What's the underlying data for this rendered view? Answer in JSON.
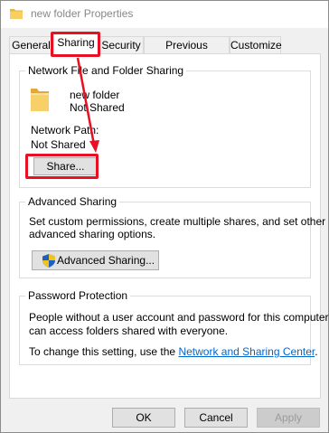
{
  "window": {
    "title": "new folder Properties",
    "icon": "folder-icon"
  },
  "tabs": [
    {
      "label": "General",
      "active": false
    },
    {
      "label": "Sharing",
      "active": true
    },
    {
      "label": "Security",
      "active": false
    },
    {
      "label": "Previous Versions",
      "active": false
    },
    {
      "label": "Customize",
      "active": false
    }
  ],
  "network_sharing": {
    "group_label": "Network File and Folder Sharing",
    "folder_name": "new folder",
    "folder_status": "Not Shared",
    "network_path_label": "Network Path:",
    "network_path_value": "Not Shared",
    "share_button": "Share..."
  },
  "advanced_sharing": {
    "group_label": "Advanced Sharing",
    "description_line1": "Set custom permissions, create multiple shares, and set other",
    "description_line2": "advanced sharing options.",
    "button": "Advanced Sharing...",
    "button_icon": "uac-shield-icon"
  },
  "password_protection": {
    "group_label": "Password Protection",
    "text_line1": "People without a user account and password for this computer",
    "text_line2": "can access folders shared with everyone.",
    "change_prefix": "To change this setting, use the ",
    "link_text": "Network and Sharing Center",
    "change_suffix": "."
  },
  "footer": {
    "ok": "OK",
    "cancel": "Cancel",
    "apply": "Apply"
  },
  "colors": {
    "annotation": "#e81123",
    "link": "#0066cc",
    "folder": "#f4c34d"
  }
}
